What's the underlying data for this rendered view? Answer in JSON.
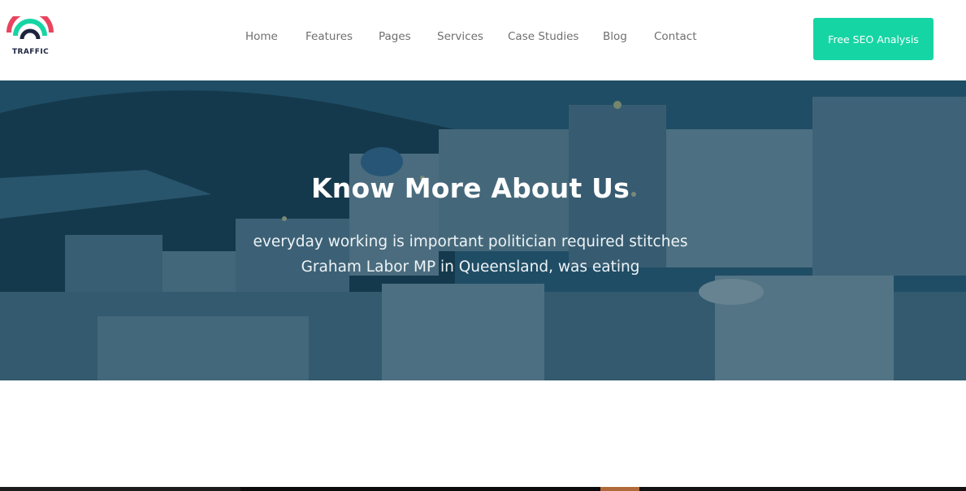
{
  "brand": {
    "name": "TRAFFIC",
    "colors": {
      "arc_outer": "#e8445f",
      "arc_middle": "#16d5a4",
      "arc_inner": "#1d2440"
    }
  },
  "nav": {
    "items": [
      {
        "label": "Home"
      },
      {
        "label": "Features"
      },
      {
        "label": "Pages"
      },
      {
        "label": "Services"
      },
      {
        "label": "Case Studies"
      },
      {
        "label": "Blog"
      },
      {
        "label": "Contact"
      }
    ]
  },
  "cta": {
    "label": "Free SEO Analysis",
    "color": "#16d5a4"
  },
  "hero": {
    "title": "Know More About Us",
    "subtitle_line1": "everyday working is important politician required stitches",
    "subtitle_line2": "Graham Labor MP in Queensland, was eating",
    "overlay_color": "#164058"
  }
}
